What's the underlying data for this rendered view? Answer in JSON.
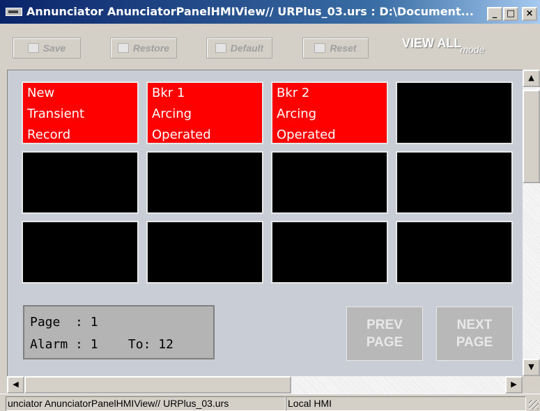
{
  "window": {
    "title": "Annunciator AnunciatorPanelHMIView// URPlus_03.urs : D:\\Document...",
    "minimize": "_",
    "maximize": "□",
    "close": "×"
  },
  "toolbar": {
    "save": "Save",
    "restore": "Restore",
    "default": "Default",
    "reset": "Reset",
    "view_all": "VIEW ALL",
    "mode": "mode"
  },
  "tiles": [
    {
      "lines": [
        "New",
        "Transient",
        "Record"
      ],
      "active": true
    },
    {
      "lines": [
        "Bkr 1",
        "Arcing",
        "Operated"
      ],
      "active": true
    },
    {
      "lines": [
        "Bkr 2",
        "Arcing",
        "Operated"
      ],
      "active": true
    },
    {
      "lines": [
        "",
        "",
        ""
      ],
      "active": false
    },
    {
      "lines": [
        "",
        "",
        ""
      ],
      "active": false
    },
    {
      "lines": [
        "",
        "",
        ""
      ],
      "active": false
    },
    {
      "lines": [
        "",
        "",
        ""
      ],
      "active": false
    },
    {
      "lines": [
        "",
        "",
        ""
      ],
      "active": false
    },
    {
      "lines": [
        "",
        "",
        ""
      ],
      "active": false
    },
    {
      "lines": [
        "",
        "",
        ""
      ],
      "active": false
    },
    {
      "lines": [
        "",
        "",
        ""
      ],
      "active": false
    },
    {
      "lines": [
        "",
        "",
        ""
      ],
      "active": false
    }
  ],
  "colors": {
    "alarm_active": "#ff0000",
    "alarm_inactive": "#000000"
  },
  "pager": {
    "page_label": "Page",
    "page_sep": ":",
    "page_value": "1",
    "alarm_label": "Alarm",
    "alarm_sep": ":",
    "alarm_value": "1",
    "to_label": "To:",
    "to_value": "12"
  },
  "nav": {
    "prev_line1": "PREV",
    "prev_line2": "PAGE",
    "next_line1": "NEXT",
    "next_line2": "PAGE"
  },
  "status": {
    "doc": "unciator AnunciatorPanelHMIView// URPlus_03.urs",
    "mode": "Local HMI"
  }
}
